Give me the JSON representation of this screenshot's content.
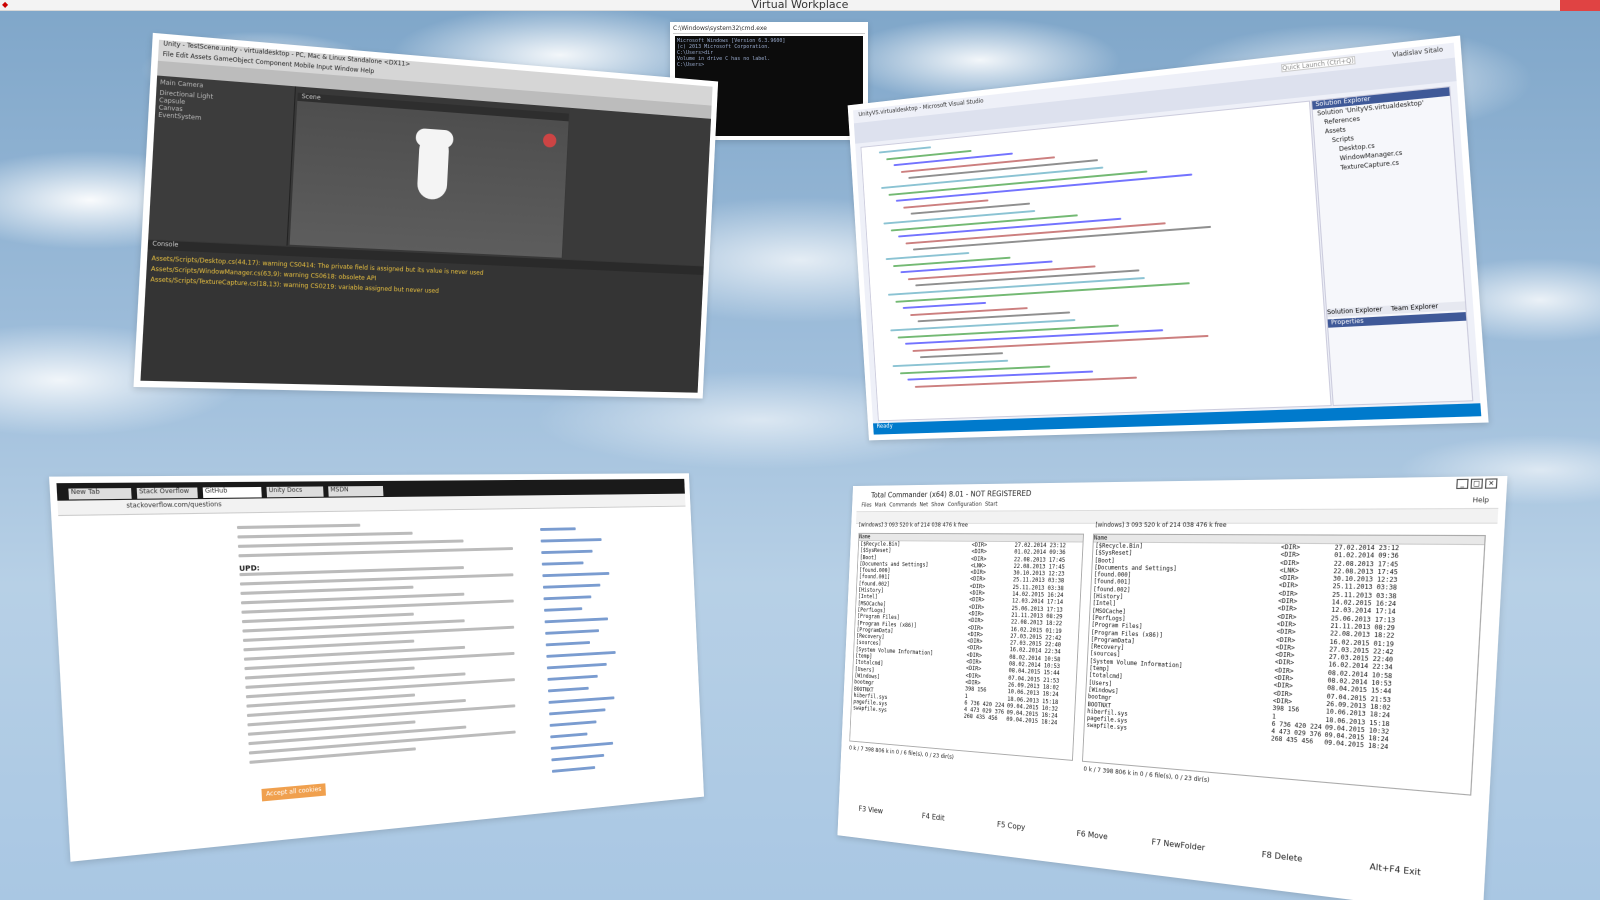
{
  "window": {
    "title": "Virtual Workplace"
  },
  "unity": {
    "title": "Unity - TestScene.unity - virtualdesktop - PC, Mac & Linux Standalone <DX11>",
    "menu": "File  Edit  Assets  GameObject  Component  Mobile Input  Window  Help",
    "hierarchy": [
      "Main Camera",
      "Directional Light",
      "Capsule",
      "Canvas",
      "EventSystem"
    ],
    "scene_tab": "Scene",
    "console_tab": "Console",
    "warnings": [
      "Assets/Scripts/Desktop.cs(44,17): warning CS0414: The private field is assigned but its value is never used",
      "Assets/Scripts/WindowManager.cs(63,9): warning CS0618: obsolete API",
      "Assets/Scripts/TextureCapture.cs(18,13): warning CS0219: variable assigned but never used"
    ]
  },
  "cmd": {
    "title": "C:\\Windows\\system32\\cmd.exe",
    "lines": [
      "Microsoft Windows [Version 6.3.9600]",
      "(c) 2013 Microsoft Corporation.",
      "",
      "C:\\Users>dir",
      " Volume in drive C has no label.",
      "",
      "C:\\Users>"
    ]
  },
  "vs": {
    "title": "UnityVS.virtualdesktop - Microsoft Visual Studio",
    "quick_launch": "Quick Launch (Ctrl+Q)",
    "user": "Vladislav Sitalo",
    "solution_explorer": "Solution Explorer",
    "tabs": [
      "Solution Explorer",
      "Team Explorer"
    ],
    "properties": "Properties",
    "tree": [
      "Solution 'UnityVS.virtualdesktop'",
      "References",
      "Assets",
      "Scripts",
      "Desktop.cs",
      "WindowManager.cs",
      "TextureCapture.cs"
    ],
    "status": "Ready"
  },
  "browser": {
    "url": "stackoverflow.com/questions",
    "tabs": [
      "New Tab",
      "Stack Overflow",
      "GitHub",
      "Unity Docs",
      "MSDN"
    ],
    "heading": "UPD:",
    "accept_button": "Accept all cookies"
  },
  "tc": {
    "title": "Total Commander (x64) 8.01 - NOT REGISTERED",
    "menu": [
      "Files",
      "Mark",
      "Commands",
      "Net",
      "Show",
      "Configuration",
      "Start"
    ],
    "help": "Help",
    "left_drive": "[windows]  3 093 520 k of 214 038 476 k free",
    "right_drive": "[windows]  3 093 520 k of 214 038 476 k free",
    "columns": [
      "Name",
      "Ext",
      "Size",
      "Date",
      "Attr"
    ],
    "left_files": [
      {
        "name": "[$Recycle.Bin]",
        "size": "<DIR>",
        "date": "27.02.2014 23:12"
      },
      {
        "name": "[$SysReset]",
        "size": "<DIR>",
        "date": "01.02.2014 09:36"
      },
      {
        "name": "[Boot]",
        "size": "<DIR>",
        "date": "22.08.2013 17:45"
      },
      {
        "name": "[Documents and Settings]",
        "size": "<LNK>",
        "date": "22.08.2013 17:45"
      },
      {
        "name": "[found.000]",
        "size": "<DIR>",
        "date": "30.10.2013 12:23"
      },
      {
        "name": "[found.001]",
        "size": "<DIR>",
        "date": "25.11.2013 03:38"
      },
      {
        "name": "[found.002]",
        "size": "<DIR>",
        "date": "25.11.2013 03:38"
      },
      {
        "name": "[History]",
        "size": "<DIR>",
        "date": "14.02.2015 16:24"
      },
      {
        "name": "[Intel]",
        "size": "<DIR>",
        "date": "12.03.2014 17:14"
      },
      {
        "name": "[MSOCache]",
        "size": "<DIR>",
        "date": "25.06.2013 17:13"
      },
      {
        "name": "[PerfLogs]",
        "size": "<DIR>",
        "date": "21.11.2013 08:29"
      },
      {
        "name": "[Program Files]",
        "size": "<DIR>",
        "date": "22.08.2013 18:22"
      },
      {
        "name": "[Program Files (x86)]",
        "size": "<DIR>",
        "date": "16.02.2015 01:19"
      },
      {
        "name": "[ProgramData]",
        "size": "<DIR>",
        "date": "27.03.2015 22:42"
      },
      {
        "name": "[Recovery]",
        "size": "<DIR>",
        "date": "27.03.2015 22:40"
      },
      {
        "name": "[sources]",
        "size": "<DIR>",
        "date": "16.02.2014 22:34"
      },
      {
        "name": "[System Volume Information]",
        "size": "<DIR>",
        "date": "08.02.2014 10:58"
      },
      {
        "name": "[temp]",
        "size": "<DIR>",
        "date": "08.02.2014 10:53"
      },
      {
        "name": "[totalcmd]",
        "size": "<DIR>",
        "date": "08.04.2015 15:44"
      },
      {
        "name": "[Users]",
        "size": "<DIR>",
        "date": "07.04.2015 21:53"
      },
      {
        "name": "[Windows]",
        "size": "<DIR>",
        "date": "26.09.2013 18:02"
      },
      {
        "name": "bootmgr",
        "size": "398 156",
        "date": "10.06.2013 18:24"
      },
      {
        "name": "BOOTNXT",
        "size": "1",
        "date": "18.06.2013 15:18"
      },
      {
        "name": "hiberfil.sys",
        "size": "6 736 420 224",
        "date": "09.04.2015 10:32"
      },
      {
        "name": "pagefile.sys",
        "size": "4 473 029 376",
        "date": "09.04.2015 18:24"
      },
      {
        "name": "swapfile.sys",
        "size": "268 435 456",
        "date": "09.04.2015 18:24"
      }
    ],
    "left_status": "0 k / 7 398 806 k in 0 / 6 file(s), 0 / 23 dir(s)",
    "right_status": "0 k / 7 398 806 k in 0 / 6 file(s), 0 / 23 dir(s)",
    "fkeys": [
      "F3 View",
      "F4 Edit",
      "F5 Copy",
      "F6 Move",
      "F7 NewFolder",
      "F8 Delete",
      "Alt+F4 Exit"
    ]
  }
}
